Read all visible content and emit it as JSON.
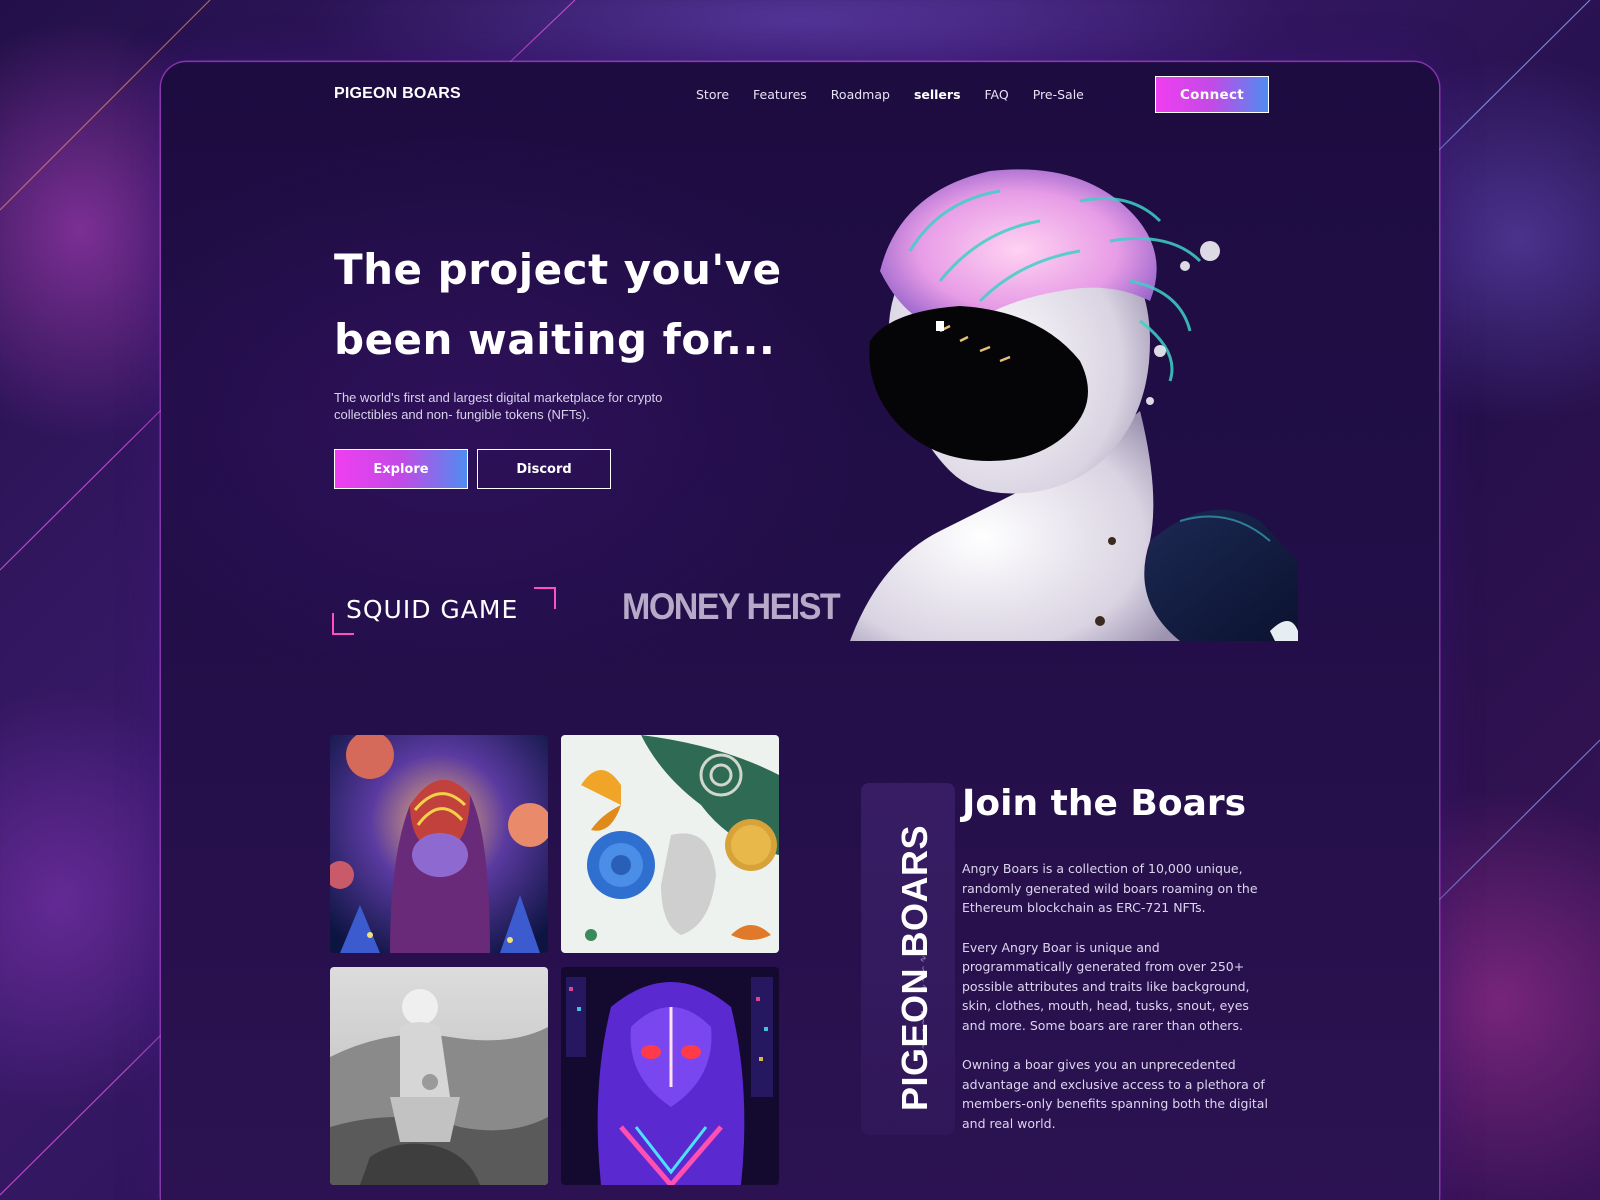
{
  "brand": {
    "name": "PIGEON BOARS"
  },
  "nav": {
    "items": [
      {
        "label": "Store"
      },
      {
        "label": "Features"
      },
      {
        "label": "Roadmap"
      },
      {
        "label": "sellers"
      },
      {
        "label": "FAQ"
      },
      {
        "label": "Pre-Sale"
      }
    ],
    "connect_label": "Connect"
  },
  "hero": {
    "title": "The project you've been waiting for...",
    "subtitle": "The world's first and largest digital marketplace for crypto collectibles and non- fungible tokens (NFTs).",
    "explore_label": "Explore",
    "discord_label": "Discord"
  },
  "partners": {
    "squid_game": "SQUID GAME",
    "money_heist": "MONEY HEIST"
  },
  "join": {
    "vertical_title": "PIGEON BOARS",
    "title": "Join the Boars",
    "paragraphs": [
      "Angry Boars is a collection of 10,000 unique, randomly generated wild boars roaming on the Ethereum blockchain as ERC-721 NFTs.",
      "Every Angry Boar is unique and programmatically generated from over 250+ possible attributes and traits like background, skin, clothes, mouth, head, tusks, snout, eyes and more. Some boars are rarer than others.",
      "Owning a boar gives you an unprecedented advantage and exclusive access to a plethora of members-only benefits spanning both the digital and real world."
    ]
  },
  "colors": {
    "accent_pink": "#f03ef0",
    "accent_blue": "#4f8df0",
    "background": "#1d0c40"
  }
}
